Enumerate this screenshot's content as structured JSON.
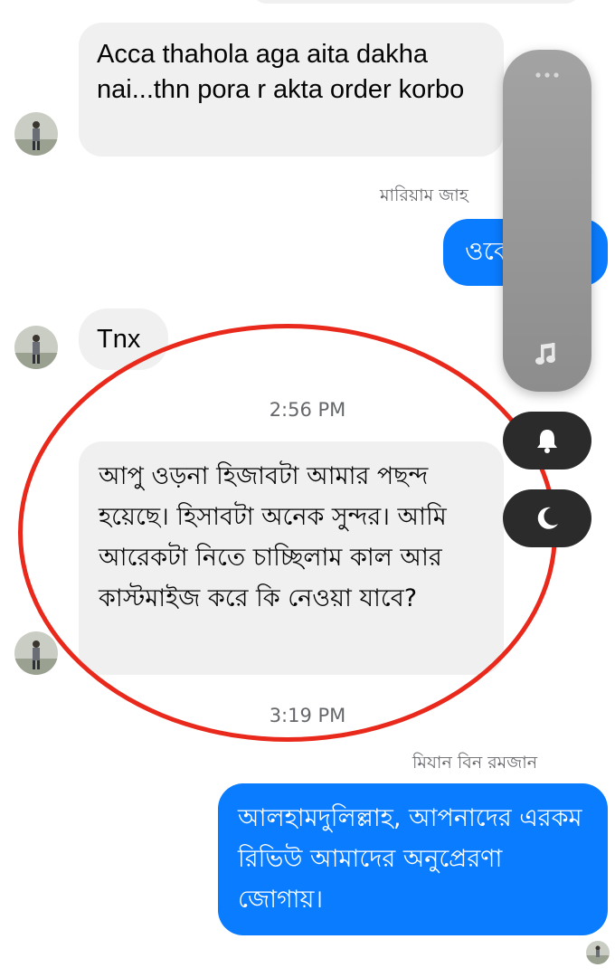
{
  "conversation": {
    "messages": [
      {
        "direction": "in",
        "text": "Acca thahola aga aita dakha nai...thn pora r akta order korbo"
      },
      {
        "direction": "out",
        "text": "ওকে"
      },
      {
        "direction": "in",
        "text": "Tnx"
      },
      {
        "direction": "in",
        "text": "আপু ওড়না হিজাবটা আমার পছন্দ হয়েছে। হিসাবটা অনেক সুন্দর। আমি আরেকটা নিতে চাচ্ছিলাম কাল আর কাস্টমাইজ করে কি নেওয়া যাবে?"
      },
      {
        "direction": "out",
        "text": "আলহামদুলিল্লাহ, আপনাদের এরকম রিভিউ আমাদের অনুপ্রেরণা জোগায়।"
      }
    ],
    "senders": [
      "মারিয়াম জাহ",
      "মিযান বিন রমজান"
    ],
    "timestamps": [
      "2:56 PM",
      "3:19 PM"
    ]
  },
  "overlay": {
    "volume_menu_icon": "more-dots-icon",
    "media_icon": "music-note-icon",
    "ring_icon": "bell-icon",
    "dnd_icon": "moon-icon"
  },
  "colors": {
    "outgoing_bubble": "#0a7cff",
    "incoming_bubble": "#f0f0f0",
    "annotation_circle": "#e8291c"
  }
}
